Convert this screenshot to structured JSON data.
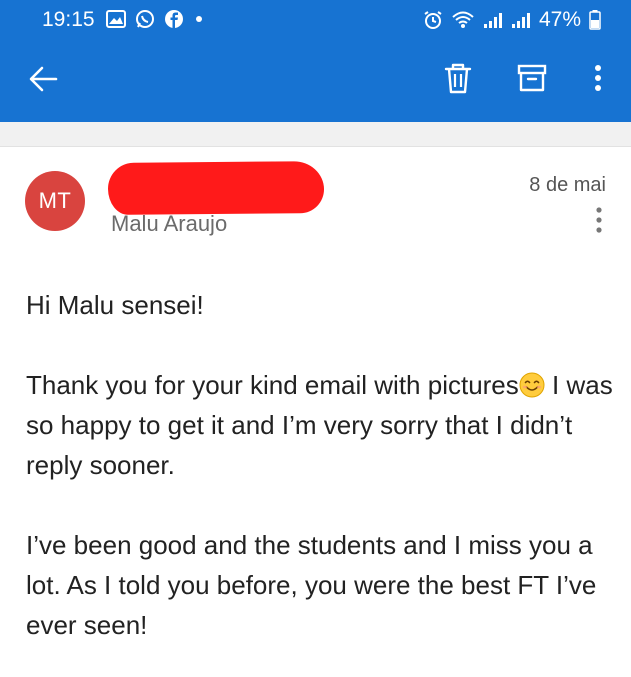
{
  "status_bar": {
    "time": "19:15",
    "battery_percent": "47%",
    "notification_icons": [
      "gallery-icon",
      "whatsapp-icon",
      "facebook-icon",
      "dot-icon"
    ],
    "system_icons": [
      "alarm-icon",
      "wifi-icon",
      "signal-icon",
      "signal-icon",
      "battery-icon"
    ]
  },
  "app_bar": {
    "actions": [
      "back-arrow-icon",
      "trash-icon",
      "archive-icon",
      "more-vertical-icon"
    ],
    "color": "#1773d2"
  },
  "message": {
    "avatar_initials": "MT",
    "avatar_color": "#d9443f",
    "sender_name": "Malu Araujo",
    "date": "8 de mai",
    "greeting": "Hi Malu sensei!",
    "paragraph1_a": "Thank you for your kind email with pictures",
    "paragraph1_b": " I was so happy to get it and I’m very sorry that I didn’t  reply sooner.",
    "paragraph2": "I’ve been good and the students and I  miss you a lot. As I told you before, you were the best FT I’ve ever seen!"
  }
}
